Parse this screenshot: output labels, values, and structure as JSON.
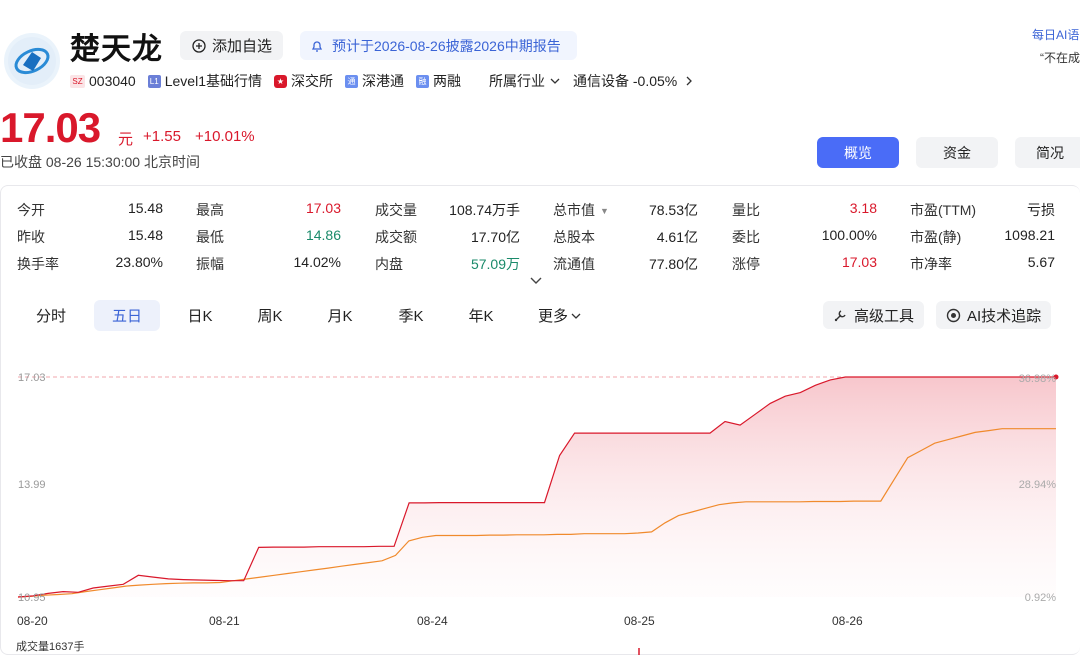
{
  "header": {
    "name": "楚天龙",
    "watch_label": "添加自选",
    "notice": "预计于2026-08-26披露2026中期报告",
    "ai_corner_title": "每日AI语",
    "ai_corner_text": "“不在成",
    "exchange_badge": "SZ",
    "code": "003040",
    "level_badge": "L1",
    "level_label": "Level1基础行情",
    "exchange_label": "深交所",
    "connect_badge": "通",
    "connect_label": "深港通",
    "margin_badge": "融",
    "margin_label": "两融",
    "industry_label": "所属行业",
    "industry_value": "通信设备 -0.05%"
  },
  "price": {
    "last": "17.03",
    "unit": "元",
    "change": "+1.55",
    "change_pct": "+10.01%",
    "status": "已收盘 08-26 15:30:00 北京时间"
  },
  "tabs": {
    "overview": "概览",
    "funds": "资金",
    "profile": "简况"
  },
  "quote": {
    "rows": [
      [
        {
          "label": "今开",
          "value": "15.48",
          "tone": "n"
        },
        {
          "label": "最高",
          "value": "17.03",
          "tone": "r"
        },
        {
          "label": "成交量",
          "value": "108.74万手",
          "tone": "n"
        },
        {
          "label": "总市值",
          "value": "78.53亿",
          "tone": "n"
        },
        {
          "label": "量比",
          "value": "3.18",
          "tone": "r"
        },
        {
          "label": "市盈(TTM)",
          "value": "亏损",
          "tone": "n"
        }
      ],
      [
        {
          "label": "昨收",
          "value": "15.48",
          "tone": "n"
        },
        {
          "label": "最低",
          "value": "14.86",
          "tone": "g"
        },
        {
          "label": "成交额",
          "value": "17.70亿",
          "tone": "n"
        },
        {
          "label": "总股本",
          "value": "4.61亿",
          "tone": "n"
        },
        {
          "label": "委比",
          "value": "100.00%",
          "tone": "n"
        },
        {
          "label": "市盈(静)",
          "value": "1098.21",
          "tone": "n"
        }
      ],
      [
        {
          "label": "换手率",
          "value": "23.80%",
          "tone": "n"
        },
        {
          "label": "振幅",
          "value": "14.02%",
          "tone": "n"
        },
        {
          "label": "内盘",
          "value": "57.09万",
          "tone": "g"
        },
        {
          "label": "流通值",
          "value": "77.80亿",
          "tone": "n"
        },
        {
          "label": "涨停",
          "value": "17.03",
          "tone": "r"
        },
        {
          "label": "市净率",
          "value": "5.67",
          "tone": "n"
        }
      ]
    ]
  },
  "period_tabs": [
    "分时",
    "五日",
    "日K",
    "周K",
    "月K",
    "季K",
    "年K",
    "更多"
  ],
  "active_period": "五日",
  "tools": {
    "advanced": "高级工具",
    "ai_tracking": "AI技术追踪"
  },
  "colors": {
    "up": "#d9182b",
    "down": "#1a8a6a",
    "accent": "#4a6cf7",
    "avg_line": "#f08a2c"
  },
  "chart_data": {
    "type": "line",
    "x_labels": [
      "08-20",
      "08-21",
      "08-24",
      "08-25",
      "08-26"
    ],
    "y_ticks_left": [
      "17.03",
      "13.99",
      "10.95"
    ],
    "y_ticks_right": [
      "36.98%",
      "28.94%",
      "0.92%"
    ],
    "ylim": [
      10.95,
      17.03
    ],
    "grid": false,
    "series": [
      {
        "values": [
          10.95,
          10.98,
          11.05,
          11.1,
          11.08,
          11.2,
          11.25,
          11.3,
          11.55,
          11.5,
          11.45,
          11.43,
          11.42,
          11.41,
          11.4,
          11.4,
          12.32,
          12.33,
          12.33,
          12.33,
          12.34,
          12.34,
          12.34,
          12.34,
          12.35,
          12.35,
          13.55,
          13.55,
          13.56,
          13.56,
          13.56,
          13.56,
          13.56,
          13.56,
          13.56,
          13.56,
          14.86,
          15.48,
          15.48,
          15.48,
          15.48,
          15.48,
          15.48,
          15.48,
          15.48,
          15.48,
          15.48,
          15.8,
          15.7,
          16.0,
          16.3,
          16.5,
          16.6,
          16.8,
          16.95,
          17.03,
          17.03,
          17.03,
          17.03,
          17.03,
          17.03,
          17.03,
          17.03,
          17.03,
          17.03,
          17.03,
          17.03,
          17.03,
          17.03,
          17.03
        ]
      },
      {
        "values": [
          10.95,
          10.97,
          11.0,
          11.02,
          11.04,
          11.1,
          11.15,
          11.2,
          11.25,
          11.28,
          11.3,
          11.32,
          11.33,
          11.34,
          11.34,
          11.35,
          11.4,
          11.45,
          11.5,
          11.55,
          11.6,
          11.65,
          11.7,
          11.75,
          11.8,
          11.85,
          11.9,
          11.95,
          12.1,
          12.5,
          12.6,
          12.65,
          12.65,
          12.65,
          12.65,
          12.66,
          12.66,
          12.67,
          12.67,
          12.67,
          12.68,
          12.68,
          12.7,
          12.7,
          12.7,
          12.7,
          12.72,
          12.75,
          13.0,
          13.2,
          13.3,
          13.4,
          13.5,
          13.55,
          13.58,
          13.58,
          13.58,
          13.58,
          13.58,
          13.59,
          13.59,
          13.59,
          13.6,
          13.6,
          13.6,
          14.2,
          14.8,
          15.0,
          15.2,
          15.3,
          15.4,
          15.5,
          15.55,
          15.6,
          15.6,
          15.6,
          15.6,
          15.6
        ]
      }
    ]
  },
  "volume_label": "成交量1637手"
}
